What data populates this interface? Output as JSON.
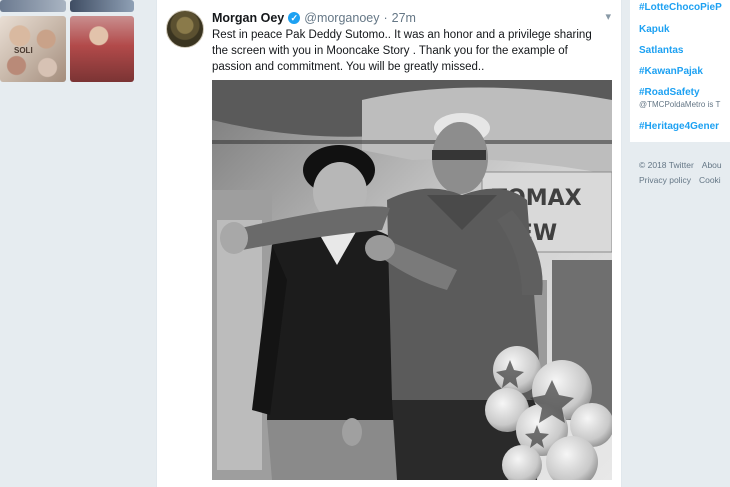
{
  "tweet": {
    "display_name": "Morgan Oey",
    "handle": "@morganoey",
    "separator": "·",
    "timestamp": "27m",
    "text": "Rest in peace Pak Deddy Sutomo.. It was an honor and a privilege sharing the screen with you in Mooncake Story . Thank you for the example of passion and commitment. You will be greatly missed..",
    "photo_sign_text_1": "TOMAX",
    "photo_sign_text_2": "SEW"
  },
  "left_thumbnails": {
    "partial_text": "SOLI"
  },
  "trends": [
    {
      "label": "#LotteChocoPieP"
    },
    {
      "label": "Kapuk"
    },
    {
      "label": "Satlantas"
    },
    {
      "label": "#KawanPajak"
    },
    {
      "label": "#RoadSafety",
      "sub": "@TMCPoldaMetro is T"
    },
    {
      "label": "#Heritage4Gener"
    }
  ],
  "footer": {
    "copyright": "© 2018 Twitter",
    "about": "Abou",
    "privacy": "Privacy policy",
    "cookies": "Cooki"
  },
  "colors": {
    "link_blue": "#1da1f2",
    "background": "#e6ecf0",
    "muted_text": "#657786"
  }
}
